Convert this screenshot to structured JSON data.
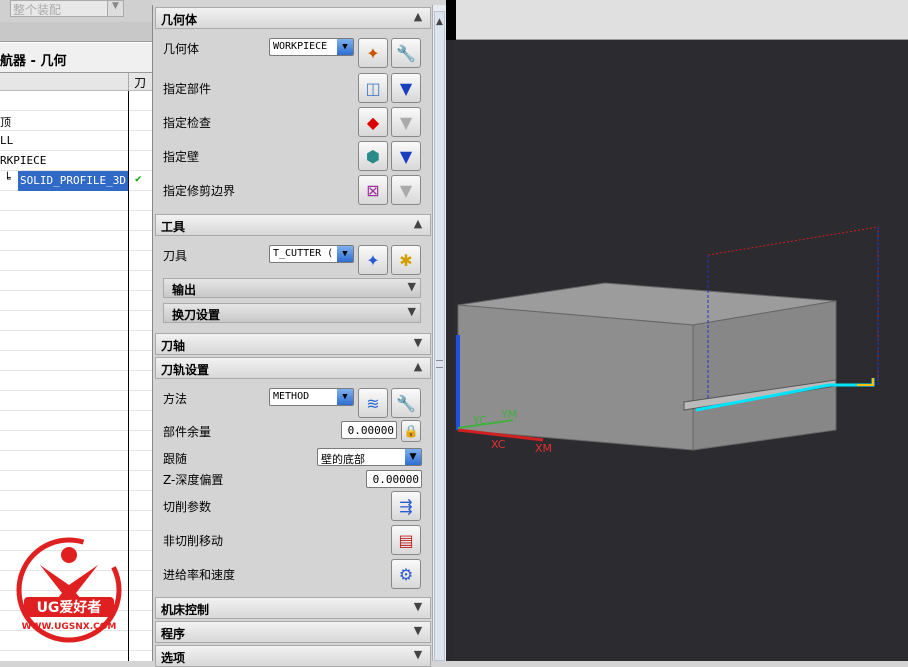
{
  "left_panel": {
    "assembly_combo": "整个装配",
    "title": "航器 - 几何",
    "col_header": "刀",
    "rows": [
      "",
      "顶",
      "LL",
      "RKPIECE",
      "SOLID_PROFILE_3D"
    ]
  },
  "dialog": {
    "geometry": {
      "header": "几何体",
      "geometry_label": "几何体",
      "geometry_value": "WORKPIECE",
      "part_label": "指定部件",
      "check_label": "指定检查",
      "wall_label": "指定壁",
      "trim_label": "指定修剪边界"
    },
    "tool": {
      "header": "工具",
      "tool_label": "刀具",
      "tool_value": "T_CUTTER (",
      "output_label": "输出",
      "tool_change_label": "换刀设置"
    },
    "axis": {
      "header": "刀轴"
    },
    "path": {
      "header": "刀轨设置",
      "method_label": "方法",
      "method_value": "METHOD",
      "stock_label": "部件余量",
      "stock_value": "0.00000",
      "follow_label": "跟随",
      "follow_value": "壁的底部",
      "zdepth_label": "Z-深度偏置",
      "zdepth_value": "0.00000",
      "cut_params_label": "切削参数",
      "noncut_label": "非切削移动",
      "feeds_label": "进给率和速度"
    },
    "machine_control": {
      "header": "机床控制"
    },
    "program": {
      "header": "程序"
    },
    "options": {
      "header": "选项"
    }
  },
  "viewport": {
    "axes": {
      "xc": "XC",
      "yc": "YC",
      "xm": "XM",
      "ym": "YM"
    },
    "background": "#2b2b30",
    "toolpath_color": "#00e5ff"
  },
  "watermark": {
    "text": "UG爱好者",
    "url": "WWW.UGSNX.COM"
  }
}
